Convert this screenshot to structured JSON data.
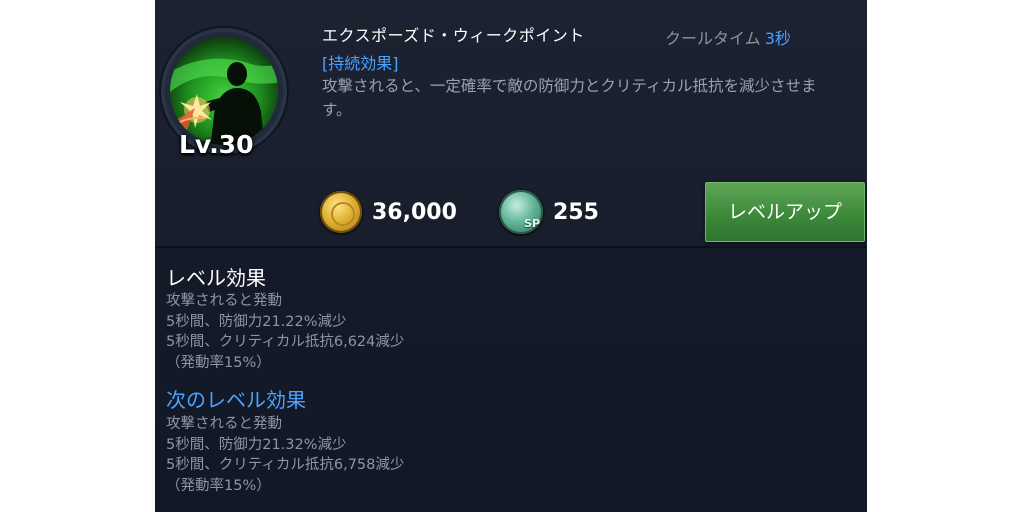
{
  "skill": {
    "name": "エクスポーズド・ウィークポイント",
    "icon": "skill-weakpoint-icon",
    "level_label": "Lv.30",
    "cooldown_label": "クールタイム",
    "cooldown_value": "3秒",
    "tag": "[持続効果]",
    "description": "攻撃されると、一定確率で敵の防御力とクリティカル抵抗を減少させます。"
  },
  "costs": {
    "gold": {
      "icon": "gold-coin-icon",
      "value": "36,000"
    },
    "sp": {
      "icon": "sp-icon",
      "icon_label": "SP",
      "value": "255"
    }
  },
  "level_up_button": {
    "label": "レベルアップ"
  },
  "current_effect": {
    "title": "レベル効果",
    "lines": [
      "攻撃されると発動",
      "5秒間、防御力21.22%減少",
      "5秒間、クリティカル抵抗6,624減少",
      "（発動率15%）"
    ]
  },
  "next_effect": {
    "title": "次のレベル効果",
    "lines": [
      "攻撃されると発動",
      "5秒間、防御力21.32%減少",
      "5秒間、クリティカル抵抗6,758減少",
      "（発動率15%）"
    ]
  },
  "colors": {
    "accent_blue": "#4aa3ff",
    "button_green": "#3d8a3a",
    "panel_bg": "#1a2030"
  }
}
